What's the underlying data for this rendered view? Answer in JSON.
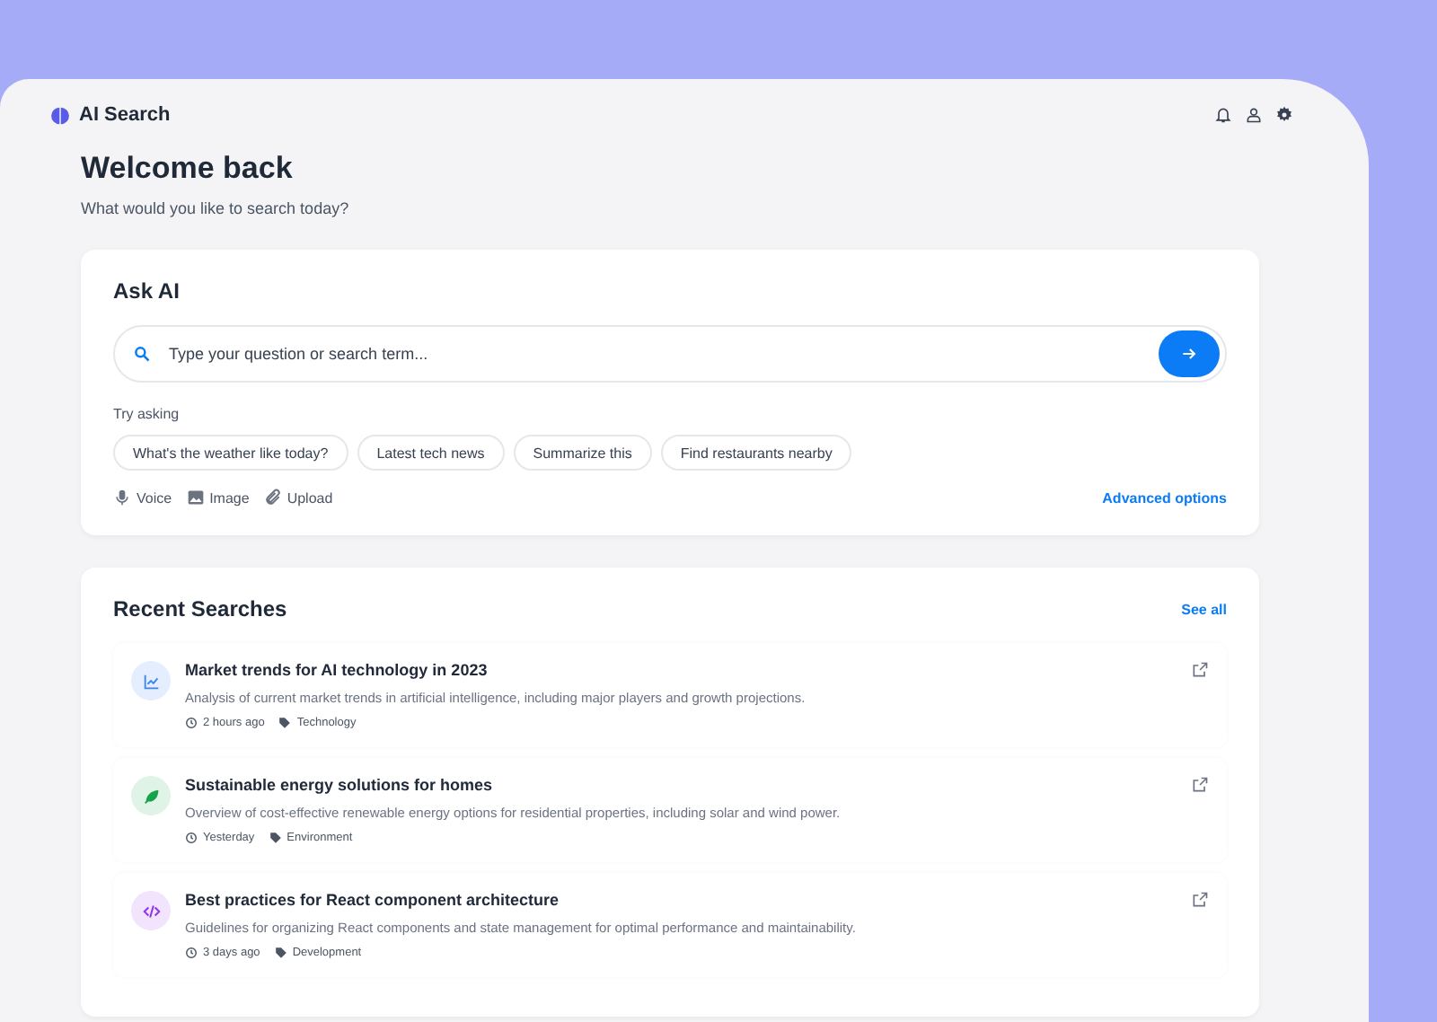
{
  "app": {
    "name": "AI Search"
  },
  "greeting": {
    "title": "Welcome back",
    "subtitle": "What would you like to search today?"
  },
  "ask": {
    "title": "Ask AI",
    "search": {
      "placeholder": "Type your question or search term..."
    },
    "try_label": "Try asking",
    "suggestions": [
      "What's the weather like today?",
      "Latest tech news",
      "Summarize this",
      "Find restaurants nearby"
    ],
    "tools": [
      {
        "kind": "voice",
        "label": "Voice"
      },
      {
        "kind": "image",
        "label": "Image"
      },
      {
        "kind": "upload",
        "label": "Upload"
      }
    ],
    "advanced": "Advanced options"
  },
  "recent": {
    "title": "Recent Searches",
    "see_all": "See all",
    "items": [
      {
        "kind": "chart",
        "color": "#3b82f6",
        "title": "Market trends for AI technology in 2023",
        "description": "Analysis of current market trends in artificial intelligence, including major players and growth projections.",
        "time": "2 hours ago",
        "tag": "Technology"
      },
      {
        "kind": "leaf",
        "color": "#16a34a",
        "title": "Sustainable energy solutions for homes",
        "description": "Overview of cost-effective renewable energy options for residential properties, including solar and wind power.",
        "time": "Yesterday",
        "tag": "Environment"
      },
      {
        "kind": "code",
        "color": "#9333ea",
        "title": "Best practices for React component architecture",
        "description": "Guidelines for organizing React components and state management for optimal performance and maintainability.",
        "time": "3 days ago",
        "tag": "Development"
      }
    ]
  }
}
